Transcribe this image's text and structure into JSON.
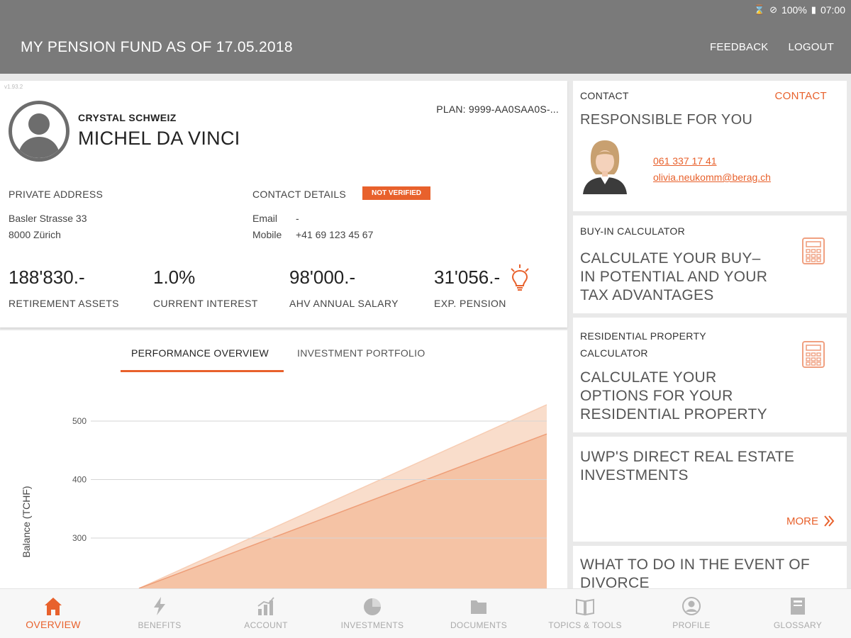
{
  "statusbar": {
    "battery": "100%",
    "time": "07:00"
  },
  "header": {
    "title": "MY PENSION FUND AS OF 17.05.2018",
    "feedback": "FEEDBACK",
    "logout": "LOGOUT"
  },
  "profile": {
    "version": "v1.93.2",
    "company": "CRYSTAL SCHWEIZ",
    "name": "MICHEL DA VINCI",
    "plan": "PLAN: 9999-AA0SAA0S-...",
    "private_address_label": "PRIVATE ADDRESS",
    "address_line1": "Basler Strasse 33",
    "address_line2": "8000 Zürich",
    "contact_details_label": "CONTACT DETAILS",
    "verification_badge": "NOT VERIFIED",
    "email_label": "Email",
    "email_value": "-",
    "mobile_label": "Mobile",
    "mobile_value": "+41 69 123 45 67"
  },
  "kpis": [
    {
      "value": "188'830.-",
      "label": "RETIREMENT ASSETS"
    },
    {
      "value": "1.0%",
      "label": "CURRENT INTEREST"
    },
    {
      "value": "98'000.-",
      "label": "AHV ANNUAL SALARY"
    },
    {
      "value": "31'056.-",
      "label": "EXP. PENSION",
      "icon": "lightbulb-icon"
    }
  ],
  "chart_tabs": {
    "active": "PERFORMANCE OVERVIEW",
    "inactive": "INVESTMENT PORTFOLIO"
  },
  "chart_data": {
    "type": "area",
    "ylabel": "Balance (TCHF)",
    "yticks": [
      300,
      400,
      500
    ],
    "ylim": [
      200,
      540
    ],
    "grid": true,
    "series": [
      {
        "start": 200,
        "end": 528,
        "color": "#f9ddcb"
      },
      {
        "start": 200,
        "end": 478,
        "color": "#f5c3a5"
      }
    ]
  },
  "contact_card": {
    "section": "CONTACT",
    "action": "CONTACT",
    "title": "RESPONSIBLE FOR YOU",
    "phone": "061 337 17 41",
    "email": "olivia.neukomm@berag.ch"
  },
  "buyin_card": {
    "section": "BUY-IN CALCULATOR",
    "text_lines": [
      "CALCULATE YOUR BUY–",
      "IN POTENTIAL AND YOUR",
      "TAX ADVANTAGES"
    ]
  },
  "property_card": {
    "section_lines": [
      "RESIDENTIAL PROPERTY",
      "CALCULATOR"
    ],
    "text_lines": [
      "CALCULATE YOUR",
      "OPTIONS FOR YOUR",
      "RESIDENTIAL PROPERTY"
    ]
  },
  "realestate_card": {
    "text_lines": [
      "UWP'S DIRECT REAL ESTATE",
      "INVESTMENTS"
    ],
    "more": "MORE"
  },
  "divorce_card": {
    "text_lines": [
      "WHAT TO DO IN THE EVENT OF",
      "DIVORCE"
    ]
  },
  "nav": [
    {
      "label": "OVERVIEW",
      "icon": "home-icon",
      "active": true
    },
    {
      "label": "BENEFITS",
      "icon": "lightning-icon"
    },
    {
      "label": "ACCOUNT",
      "icon": "bar-chart-icon"
    },
    {
      "label": "INVESTMENTS",
      "icon": "pie-chart-icon"
    },
    {
      "label": "DOCUMENTS",
      "icon": "folder-icon"
    },
    {
      "label": "TOPICS & TOOLS",
      "icon": "book-icon"
    },
    {
      "label": "PROFILE",
      "icon": "person-icon"
    },
    {
      "label": "GLOSSARY",
      "icon": "glossary-icon"
    }
  ],
  "colors": {
    "accent": "#e8612c",
    "header": "#7a7a7a",
    "background": "#e9e9e9"
  }
}
